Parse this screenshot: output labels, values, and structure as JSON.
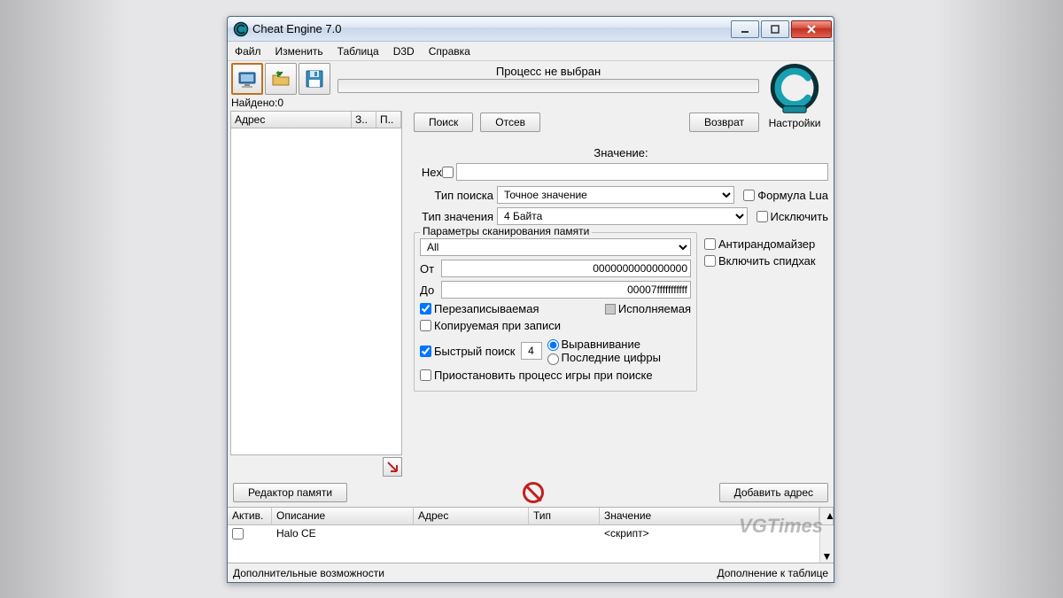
{
  "window": {
    "title": "Cheat Engine 7.0"
  },
  "menu": {
    "file": "Файл",
    "edit": "Изменить",
    "table": "Таблица",
    "d3d": "D3D",
    "help": "Справка"
  },
  "toolbar": {
    "process_label": "Процесс не выбран"
  },
  "logo_label": "Настройки",
  "found": {
    "label": "Найдено:",
    "value": "0"
  },
  "results": {
    "col_addr": "Адрес",
    "col_val": "З..",
    "col_prev": "П.."
  },
  "search": {
    "search_btn": "Поиск",
    "filter_btn": "Отсев",
    "undo_btn": "Возврат",
    "value_label": "Значение:",
    "hex_label": "Hex",
    "value_input": "",
    "scantype_label": "Тип поиска",
    "scantype_value": "Точное значение",
    "valuetype_label": "Тип значения",
    "valuetype_value": "4 Байта",
    "lua_label": "Формула Lua",
    "exclude_label": "Исключить"
  },
  "scanopts": {
    "legend": "Параметры сканирования памяти",
    "region_value": "All",
    "from_label": "От",
    "from_value": "0000000000000000",
    "to_label": "До",
    "to_value": "00007fffffffffff",
    "writable_label": "Перезаписываемая",
    "executable_label": "Исполняемая",
    "cow_label": "Копируемая при записи",
    "fastscan_label": "Быстрый поиск",
    "fastscan_value": "4",
    "align_label": "Выравнивание",
    "lastdigits_label": "Последние цифры",
    "pause_label": "Приостановить процесс игры при поиске"
  },
  "sideopts": {
    "antirand_label": "Антирандомайзер",
    "speedhack_label": "Включить спидхак"
  },
  "midbtns": {
    "mem_editor": "Редактор памяти",
    "add_addr": "Добавить адрес"
  },
  "cheat_table": {
    "col_active": "Актив.",
    "col_desc": "Описание",
    "col_addr": "Адрес",
    "col_type": "Тип",
    "col_value": "Значение",
    "rows": [
      {
        "desc": "Halo CE",
        "addr": "",
        "type": "",
        "value": "<скрипт>"
      }
    ]
  },
  "footer": {
    "left": "Дополнительные возможности",
    "right": "Дополнение к таблице"
  },
  "watermark": "VGTimes"
}
